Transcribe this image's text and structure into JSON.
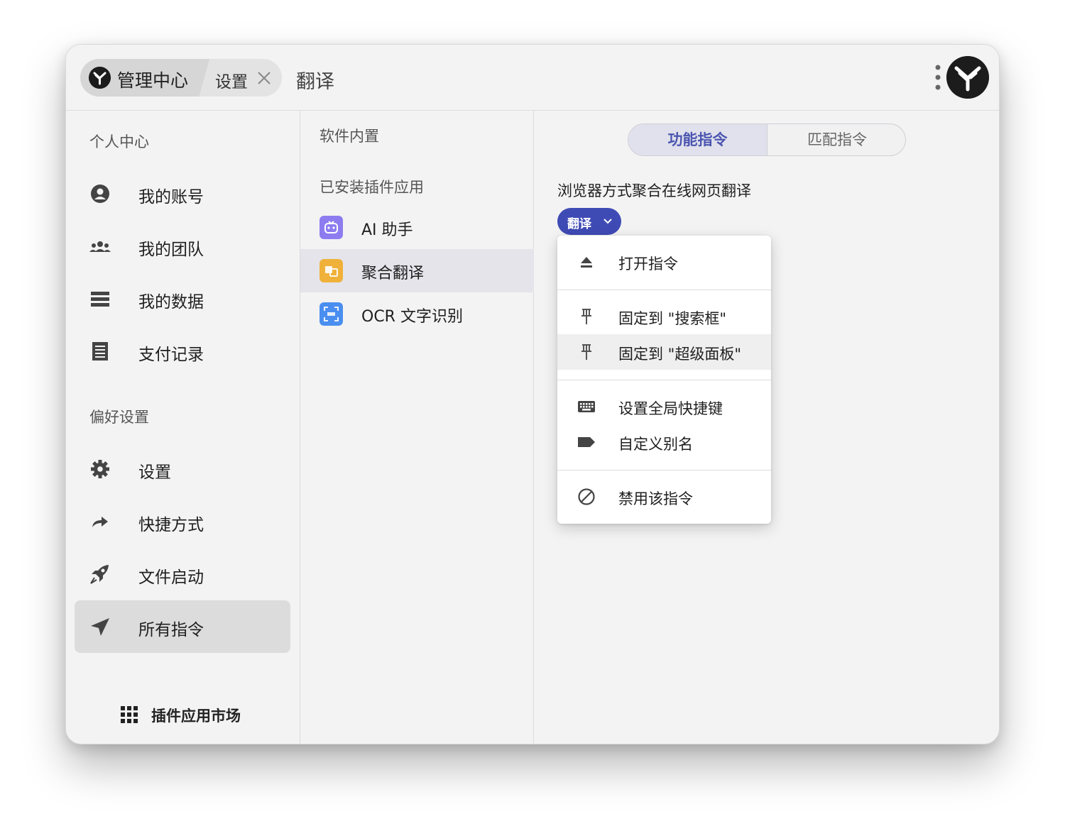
{
  "header": {
    "home_label": "管理中心",
    "settings_label": "设置",
    "title": "翻译"
  },
  "sidebar": {
    "section_personal": "个人中心",
    "personal_items": [
      {
        "label": "我的账号",
        "icon": "account-circle-icon"
      },
      {
        "label": "我的团队",
        "icon": "team-icon"
      },
      {
        "label": "我的数据",
        "icon": "data-list-icon"
      },
      {
        "label": "支付记录",
        "icon": "receipt-icon"
      }
    ],
    "section_prefs": "偏好设置",
    "pref_items": [
      {
        "label": "设置",
        "icon": "gear-icon"
      },
      {
        "label": "快捷方式",
        "icon": "share-arrow-icon"
      },
      {
        "label": "文件启动",
        "icon": "rocket-icon"
      },
      {
        "label": "所有指令",
        "icon": "send-icon"
      }
    ],
    "market_label": "插件应用市场"
  },
  "middle": {
    "builtin_label": "软件内置",
    "installed_label": "已安装插件应用",
    "plugins": [
      {
        "label": "AI 助手",
        "color": "#8c7cf0"
      },
      {
        "label": "聚合翻译",
        "color": "#f0b13a"
      },
      {
        "label": "OCR 文字识别",
        "color": "#4a8ef0"
      }
    ]
  },
  "right": {
    "tab_function": "功能指令",
    "tab_match": "匹配指令",
    "command_title": "浏览器方式聚合在线网页翻译",
    "chip_label": "翻译",
    "menu": {
      "open": "打开指令",
      "pin_search": "固定到 \"搜索框\"",
      "pin_panel": "固定到 \"超级面板\"",
      "hotkey": "设置全局快捷键",
      "alias": "自定义别名",
      "disable": "禁用该指令"
    }
  },
  "colors": {
    "accent": "#3f4bb5",
    "window_bg": "#f3f3f3"
  }
}
